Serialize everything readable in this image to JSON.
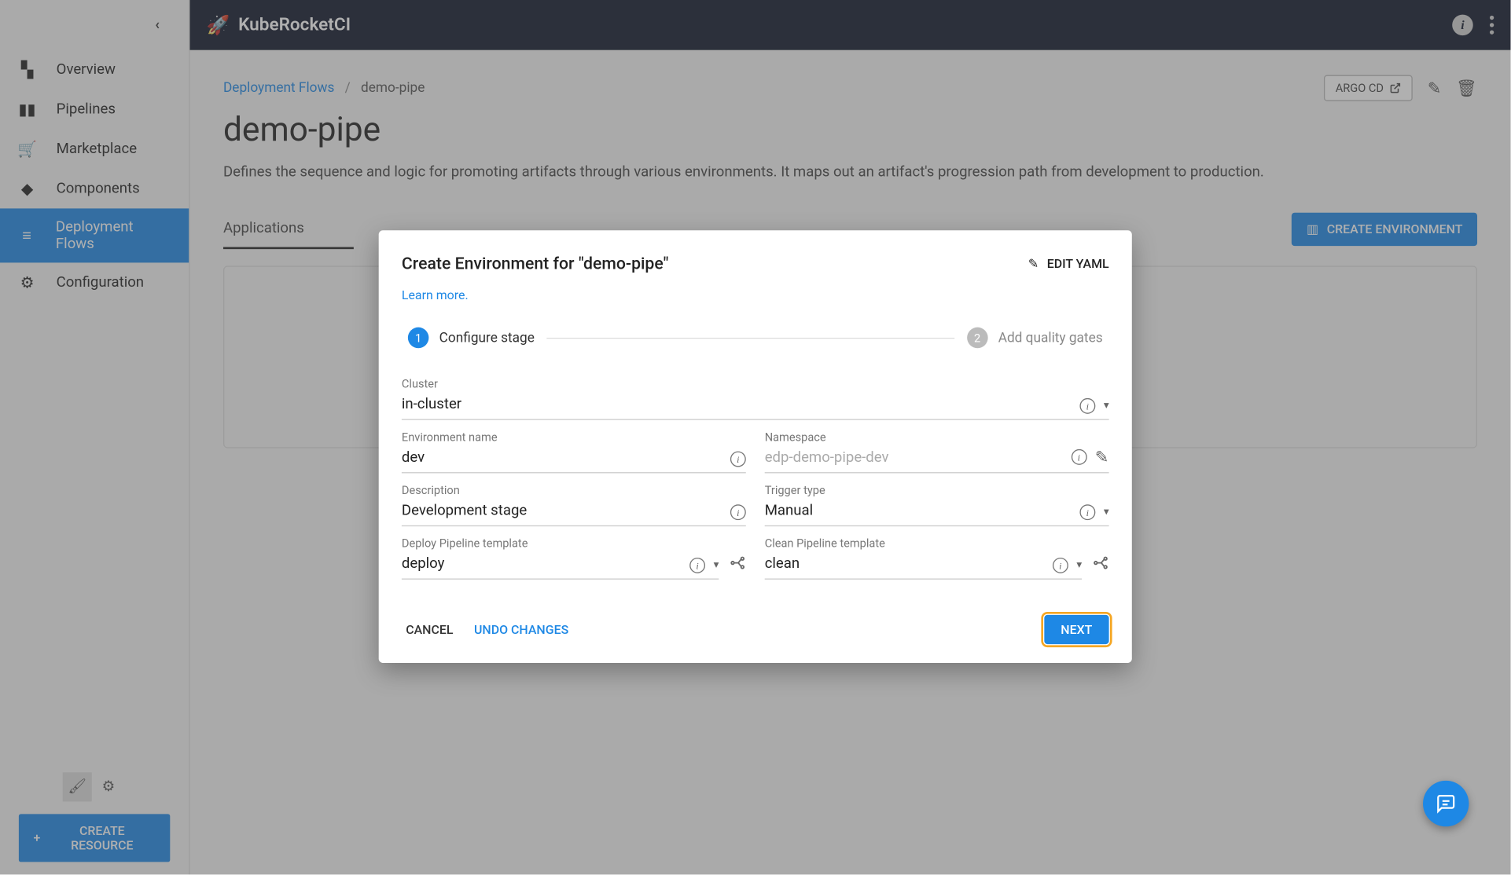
{
  "brand": "KubeRocketCI",
  "sidebar": {
    "items": [
      {
        "label": "Overview"
      },
      {
        "label": "Pipelines"
      },
      {
        "label": "Marketplace"
      },
      {
        "label": "Components"
      },
      {
        "label": "Deployment Flows"
      },
      {
        "label": "Configuration"
      }
    ],
    "createResource": "CREATE RESOURCE"
  },
  "breadcrumb": {
    "parent": "Deployment Flows",
    "sep": "/",
    "current": "demo-pipe"
  },
  "page": {
    "title": "demo-pipe",
    "desc": "Defines the sequence and logic for promoting artifacts through various environments. It maps out an artifact's progression path from development to production.",
    "argoBtn": "ARGO CD",
    "tab": "Applications",
    "createEnvBtn": "CREATE ENVIRONMENT"
  },
  "modal": {
    "title": "Create Environment for \"demo-pipe\"",
    "editYaml": "EDIT YAML",
    "learnMore": "Learn more.",
    "step1": "Configure stage",
    "step2": "Add quality gates",
    "fields": {
      "clusterLabel": "Cluster",
      "clusterValue": "in-cluster",
      "envNameLabel": "Environment name",
      "envNameValue": "dev",
      "namespaceLabel": "Namespace",
      "namespacePlaceholder": "edp-demo-pipe-dev",
      "descLabel": "Description",
      "descValue": "Development stage",
      "triggerLabel": "Trigger type",
      "triggerValue": "Manual",
      "deployTplLabel": "Deploy Pipeline template",
      "deployTplValue": "deploy",
      "cleanTplLabel": "Clean Pipeline template",
      "cleanTplValue": "clean"
    },
    "cancel": "CANCEL",
    "undo": "UNDO CHANGES",
    "next": "NEXT"
  }
}
